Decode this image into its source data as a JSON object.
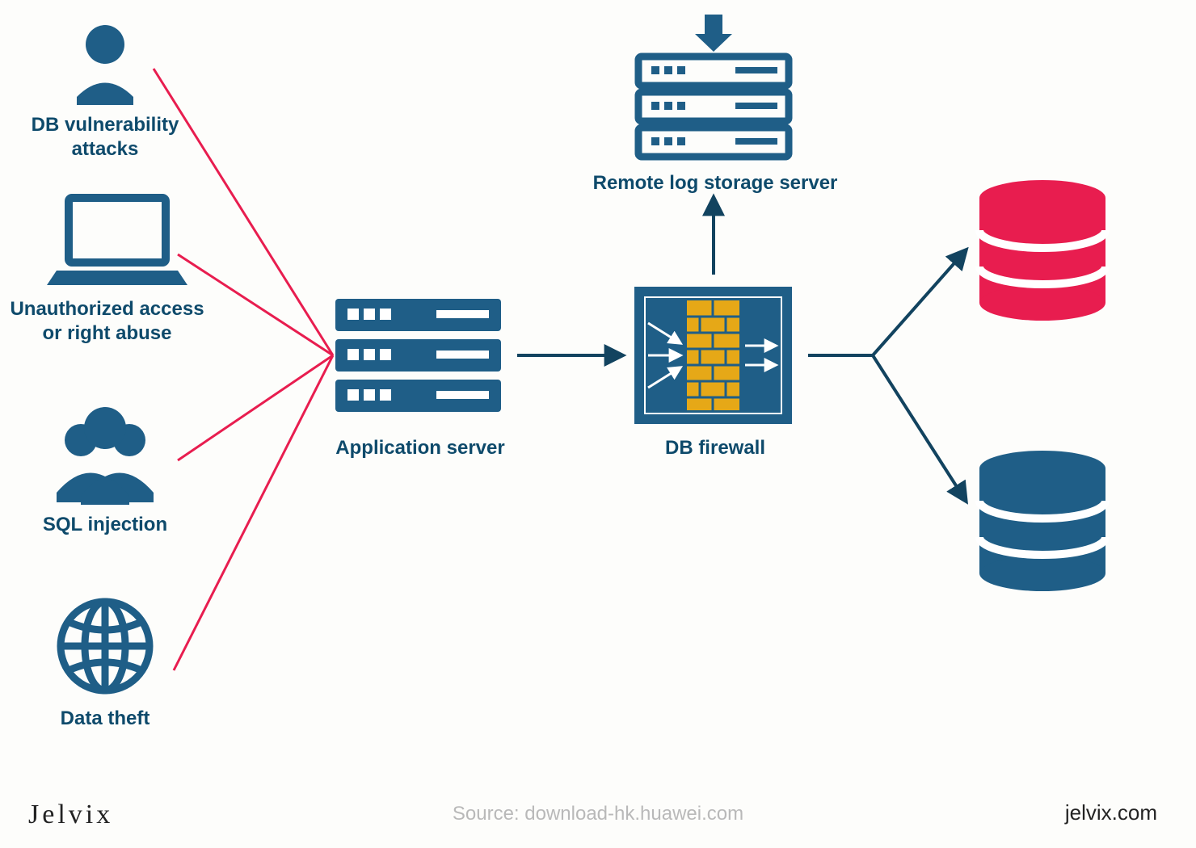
{
  "threats": {
    "db_vuln": "DB vulnerability\nattacks",
    "unauthorized": "Unauthorized access\nor right abuse",
    "sql_injection": "SQL injection",
    "data_theft": "Data theft"
  },
  "nodes": {
    "app_server": "Application server",
    "db_firewall": "DB firewall",
    "log_server": "Remote log storage server"
  },
  "footer": {
    "brand": "Jelvix",
    "source": "Source: download-hk.huawei.com",
    "site": "jelvix.com"
  },
  "colors": {
    "blue": "#1f5e87",
    "red": "#e81d4f",
    "dark": "#12435f",
    "brick": "#e6a817"
  }
}
